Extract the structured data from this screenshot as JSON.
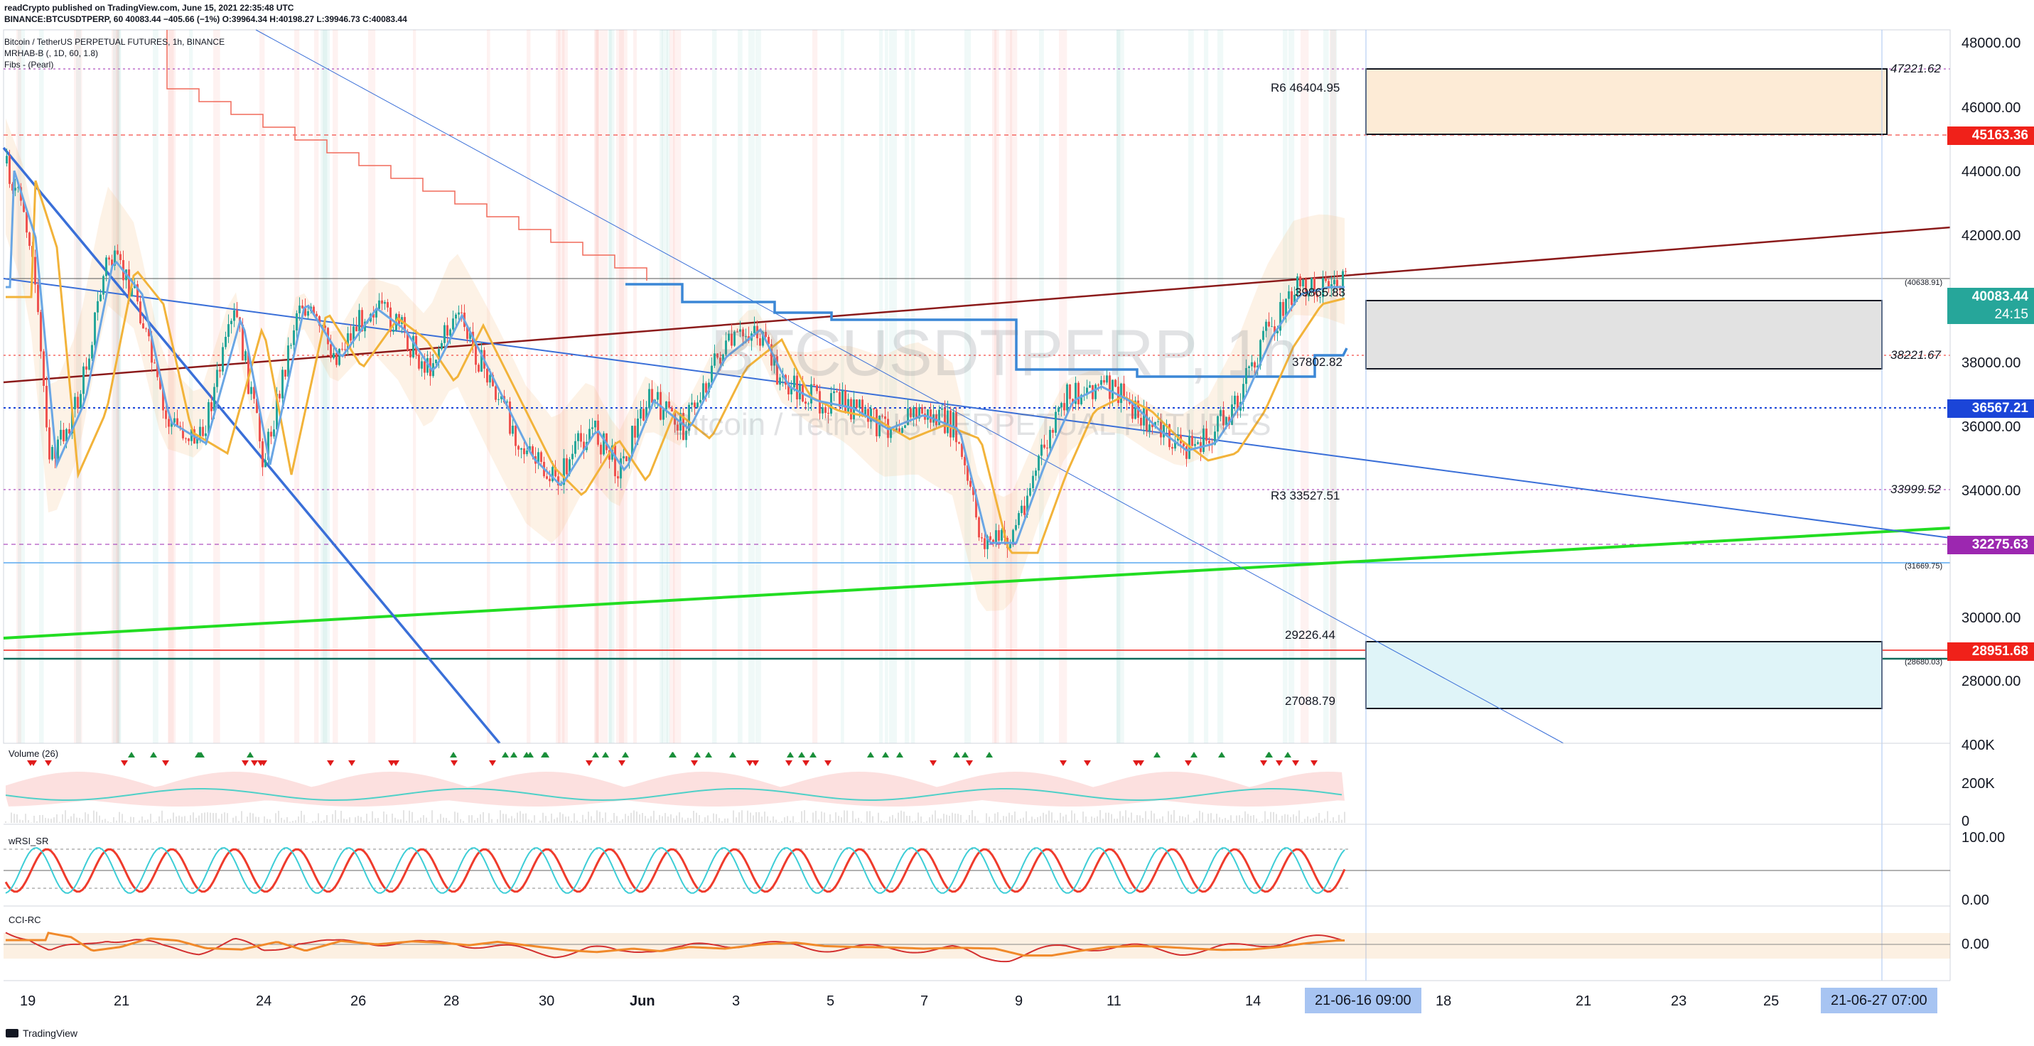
{
  "publish": {
    "line1": "readCrypto published on TradingView.com, June 15, 2021 22:35:48 UTC",
    "line2": "BINANCE:BTCUSDTPERP, 60  40083.44  −405.66 (−1%)  O:39964.34  H:40198.27  L:39946.73  C:40083.44"
  },
  "legend": {
    "symbol": "Bitcoin / TetherUS PERPETUAL FUTURES, 1h, BINANCE",
    "ind1": "MRHAB-B (, 1D, 60, 1.8)",
    "ind2": "Fibs - (Pearl)"
  },
  "watermark": {
    "symbol": "BTCUSDTPERP, 1h",
    "name": "Bitcoin / TetherUS PERPETUAL FUTURES"
  },
  "price_axis": {
    "ticks": [
      "48000.00",
      "46000.00",
      "44000.00",
      "42000.00",
      "38000.00",
      "36000.00",
      "34000.00",
      "30000.00",
      "28000.00"
    ],
    "boxes": [
      {
        "label": "45163.36",
        "color": "#f0211a"
      },
      {
        "label": "40083.44",
        "color": "#26a69a"
      },
      {
        "label": "24:15",
        "color": "#26a69a"
      },
      {
        "label": "36567.21",
        "color": "#1b45d8"
      },
      {
        "label": "32275.63",
        "color": "#9c27b0"
      },
      {
        "label": "28951.68",
        "color": "#f0211a"
      }
    ]
  },
  "levels": {
    "r6": "R6  46404.95",
    "fib1": "47221.62",
    "fib2": "(40638.91)",
    "l3": "38221.67",
    "l4": "39865.83",
    "l5": "37802.82",
    "l6": "33999.52",
    "r3": "R3  33527.51",
    "l7": "(31669.75)",
    "l8": "29226.44",
    "l9": "(28680.03)",
    "l10": "27088.79"
  },
  "panes": {
    "volume": {
      "title": "Volume (26)",
      "ticks": [
        "400K",
        "200K",
        "0"
      ]
    },
    "wrsi": {
      "title": "wRSI_SR",
      "ticks": [
        "100.00",
        "0.00"
      ]
    },
    "cci": {
      "title": "CCI-RC",
      "ticks": [
        "0.00"
      ]
    }
  },
  "time_axis": {
    "ticks": [
      "19",
      "21",
      "24",
      "26",
      "28",
      "30",
      "Jun",
      "3",
      "5",
      "7",
      "9",
      "11",
      "14",
      "18",
      "21",
      "23",
      "25"
    ],
    "boxes": [
      "21-06-16   09:00",
      "21-06-27   07:00"
    ]
  },
  "footer": {
    "brand": "TradingView"
  },
  "colors": {
    "up": "#26a69a",
    "down": "#ef5350",
    "trend_green": "#22dd22",
    "trend_blue": "#3a6fd8",
    "trend_maroon": "#8b1a1a"
  }
}
